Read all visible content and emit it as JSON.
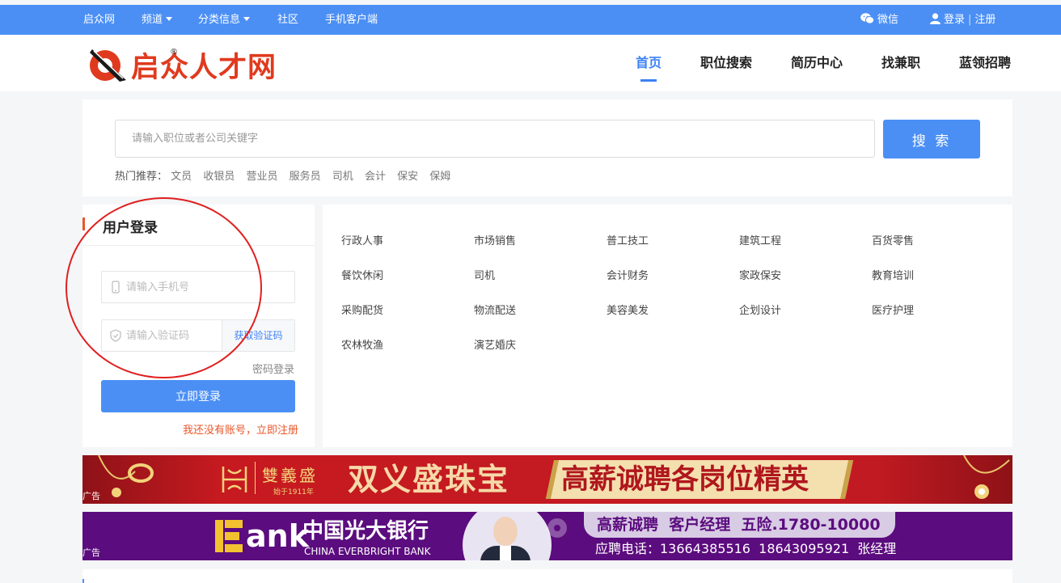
{
  "topbar": {
    "items": [
      "启众网",
      "频道",
      "分类信息",
      "社区",
      "手机客户端"
    ],
    "wechat": "微信",
    "login": "登录",
    "separator": "|",
    "register": "注册"
  },
  "header": {
    "logo_text": "启众人才网",
    "logo_reg": "®",
    "nav": [
      "首页",
      "职位搜索",
      "简历中心",
      "找兼职",
      "蓝领招聘"
    ]
  },
  "search": {
    "placeholder": "请输入职位或者公司关键字",
    "button": "搜 索",
    "hot_label": "热门推荐：",
    "hot": [
      "文员",
      "收银员",
      "营业员",
      "服务员",
      "司机",
      "会计",
      "保安",
      "保姆"
    ]
  },
  "login": {
    "title": "用户登录",
    "phone_placeholder": "请输入手机号",
    "code_placeholder": "请输入验证码",
    "get_code": "获取验证码",
    "password_login": "密码登录",
    "submit": "立即登录",
    "register_link": "我还没有账号，立即注册"
  },
  "categories": [
    [
      "行政人事",
      "市场销售",
      "普工技工",
      "建筑工程",
      "百货零售"
    ],
    [
      "餐饮休闲",
      "司机",
      "会计财务",
      "家政保安",
      "教育培训"
    ],
    [
      "采购配货",
      "物流配送",
      "美容美发",
      "企划设计",
      "医疗护理"
    ],
    [
      "农林牧渔",
      "演艺婚庆"
    ]
  ],
  "ads": {
    "ad1": {
      "tag": "广告",
      "brand_cn": "雙義盛",
      "brand_since": "始于1911年",
      "title": "双义盛珠宝",
      "slogan": "高薪诚聘各岗位精英"
    },
    "ad2": {
      "tag": "广告",
      "logo_word": "ank",
      "bank_cn": "中国光大银行",
      "bank_en": "CHINA EVERBRIGHT BANK",
      "headline": "高薪诚聘  客户经理  五险.1780-10000",
      "contact": "应聘电话：13664385516  18643095921  张经理"
    }
  },
  "colors": {
    "primary": "#4b8ff5",
    "logo_red": "#e03a1e",
    "accent_orange": "#e9572b",
    "annotation_circle": "#e02020"
  }
}
